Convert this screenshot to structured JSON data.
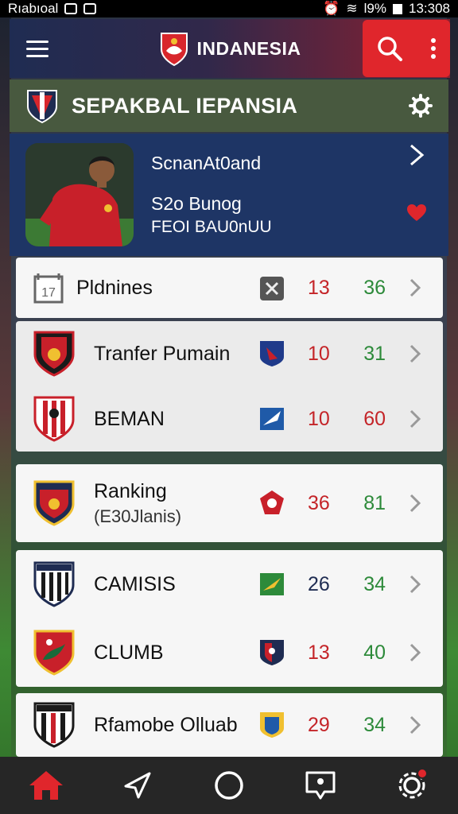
{
  "status_bar": {
    "carrier": "Rıabıoal",
    "battery_text": "l9%",
    "time": "13:308"
  },
  "header": {
    "title": "INDANESIA"
  },
  "section": {
    "title": "SEPAKBAL IEPANSIA"
  },
  "featured": {
    "name": "ScnanAt0and",
    "subtitle": "S2o Bunog",
    "subtitle2": "FEOI BAU0nUU"
  },
  "cards": [
    {
      "rows": [
        {
          "label": "Pldnines",
          "sub": "",
          "score_a": "13",
          "score_b": "36",
          "score_b_color": "green"
        }
      ]
    },
    {
      "rows": [
        {
          "label": "Tranfer Pumain",
          "sub": "",
          "score_a": "10",
          "score_b": "31",
          "score_b_color": "green"
        },
        {
          "label": "BEMAN",
          "sub": "",
          "score_a": "10",
          "score_b": "60",
          "score_b_color": "red"
        }
      ]
    },
    {
      "rows": [
        {
          "label": "Ranking",
          "sub": "(E30Jlanis)",
          "score_a": "36",
          "score_b": "81",
          "score_b_color": "green"
        }
      ]
    },
    {
      "rows": [
        {
          "label": "CAMISIS",
          "sub": "",
          "score_a": "26",
          "score_b": "34",
          "score_b_color": "green"
        },
        {
          "label": "CLUMB",
          "sub": "",
          "score_a": "13",
          "score_b": "40",
          "score_b_color": "green"
        }
      ]
    },
    {
      "rows": [
        {
          "label": "Rfamobe Olluab",
          "sub": "",
          "score_a": "29",
          "score_b": "34",
          "score_b_color": "green"
        }
      ]
    }
  ],
  "nav": [
    "home-icon",
    "send-icon",
    "circle-icon",
    "chat-location-icon",
    "settings-icon"
  ],
  "colors": {
    "accent_red": "#e0262c",
    "header_navy": "#1f2c52",
    "banner_green": "#48593f",
    "featured_blue": "#1e3565",
    "score_red": "#c42428",
    "score_green": "#2d8a3a"
  }
}
